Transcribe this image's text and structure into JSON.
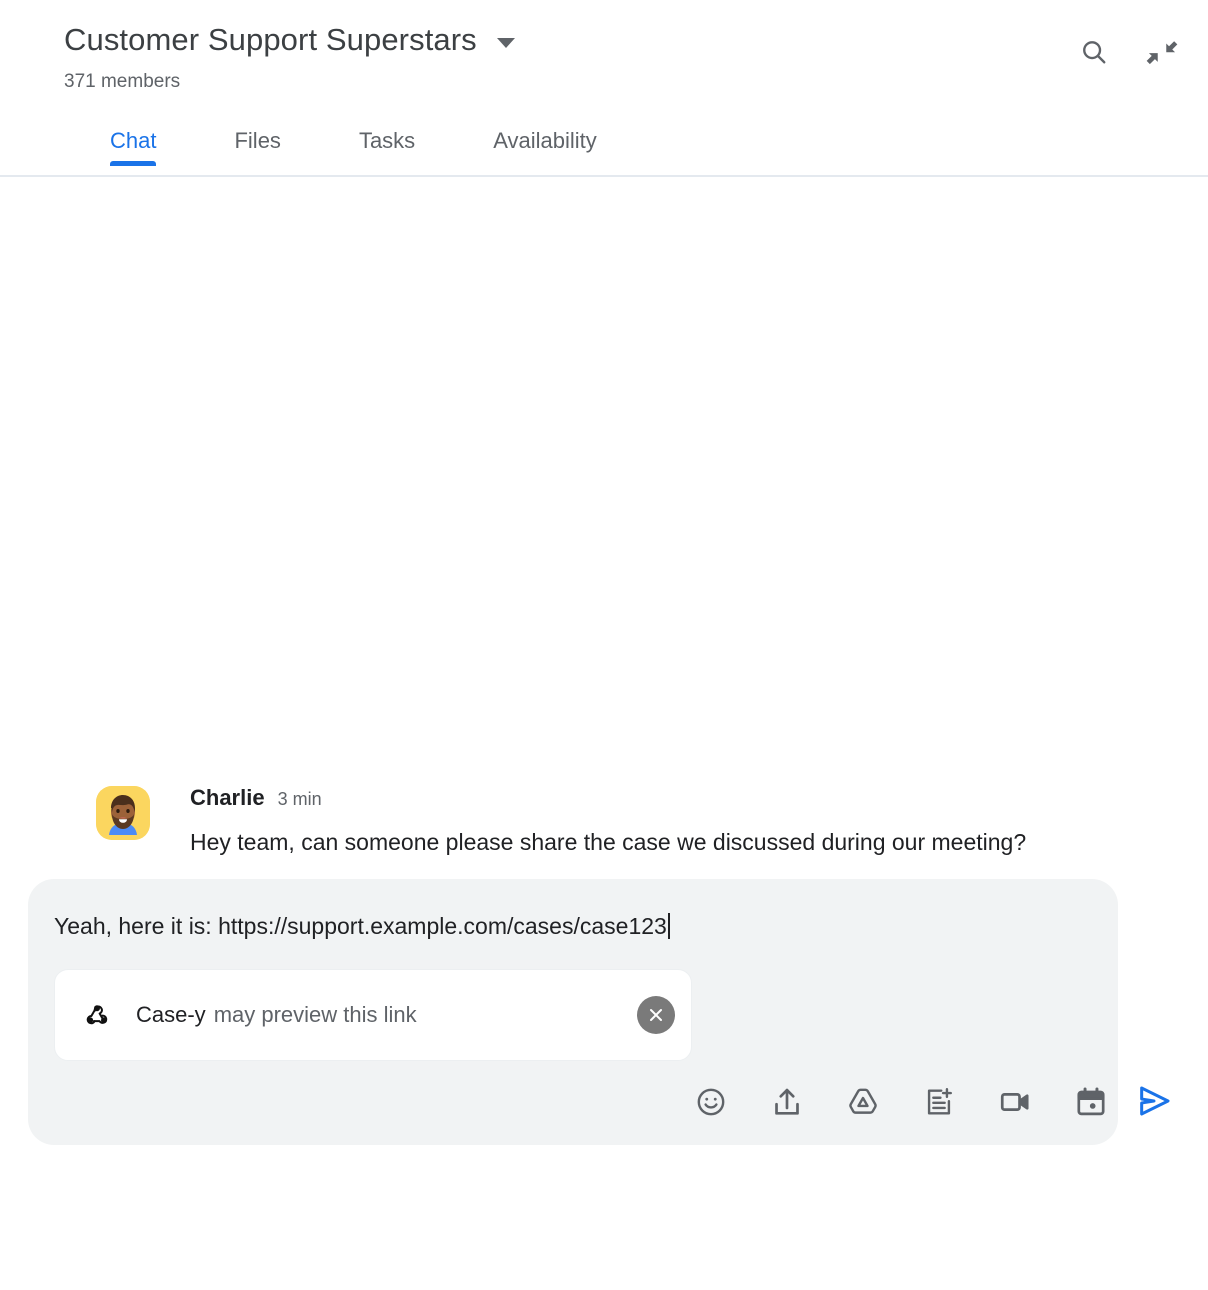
{
  "header": {
    "room_title": "Customer Support Superstars",
    "members": "371 members",
    "caret_icon": "chevron-down-icon",
    "actions": [
      {
        "name": "search-icon",
        "label": "Search"
      },
      {
        "name": "collapse-icon",
        "label": "Collapse"
      }
    ]
  },
  "tabs": [
    {
      "label": "Chat",
      "active": true
    },
    {
      "label": "Files",
      "active": false
    },
    {
      "label": "Tasks",
      "active": false
    },
    {
      "label": "Availability",
      "active": false
    }
  ],
  "messages": [
    {
      "author": "Charlie",
      "time": "3 min",
      "text": "Hey team, can someone please share the case we discussed during our meeting?",
      "avatar": "charlie-avatar"
    }
  ],
  "compose": {
    "text": "Yeah, here it is: https://support.example.com/cases/case123",
    "preview": {
      "app_name": "Case-y",
      "message": "may preview this link",
      "icon": "webhook-icon",
      "close_icon": "close-icon"
    },
    "toolbar": [
      {
        "name": "emoji-icon",
        "label": "Insert emoji"
      },
      {
        "name": "upload-icon",
        "label": "Upload file"
      },
      {
        "name": "drive-icon",
        "label": "Add from Drive"
      },
      {
        "name": "add-note-icon",
        "label": "Create a doc"
      },
      {
        "name": "video-icon",
        "label": "Add video meeting"
      },
      {
        "name": "calendar-icon",
        "label": "Schedule event"
      }
    ],
    "send": {
      "name": "send-icon",
      "label": "Send message"
    }
  },
  "colors": {
    "accent_blue": "#1a73e8",
    "text_primary": "#202124",
    "text_secondary": "#5f6368",
    "compose_bg": "#f1f3f4",
    "avatar_bg": "#fbd65f",
    "close_bg": "#7a7a7a"
  }
}
